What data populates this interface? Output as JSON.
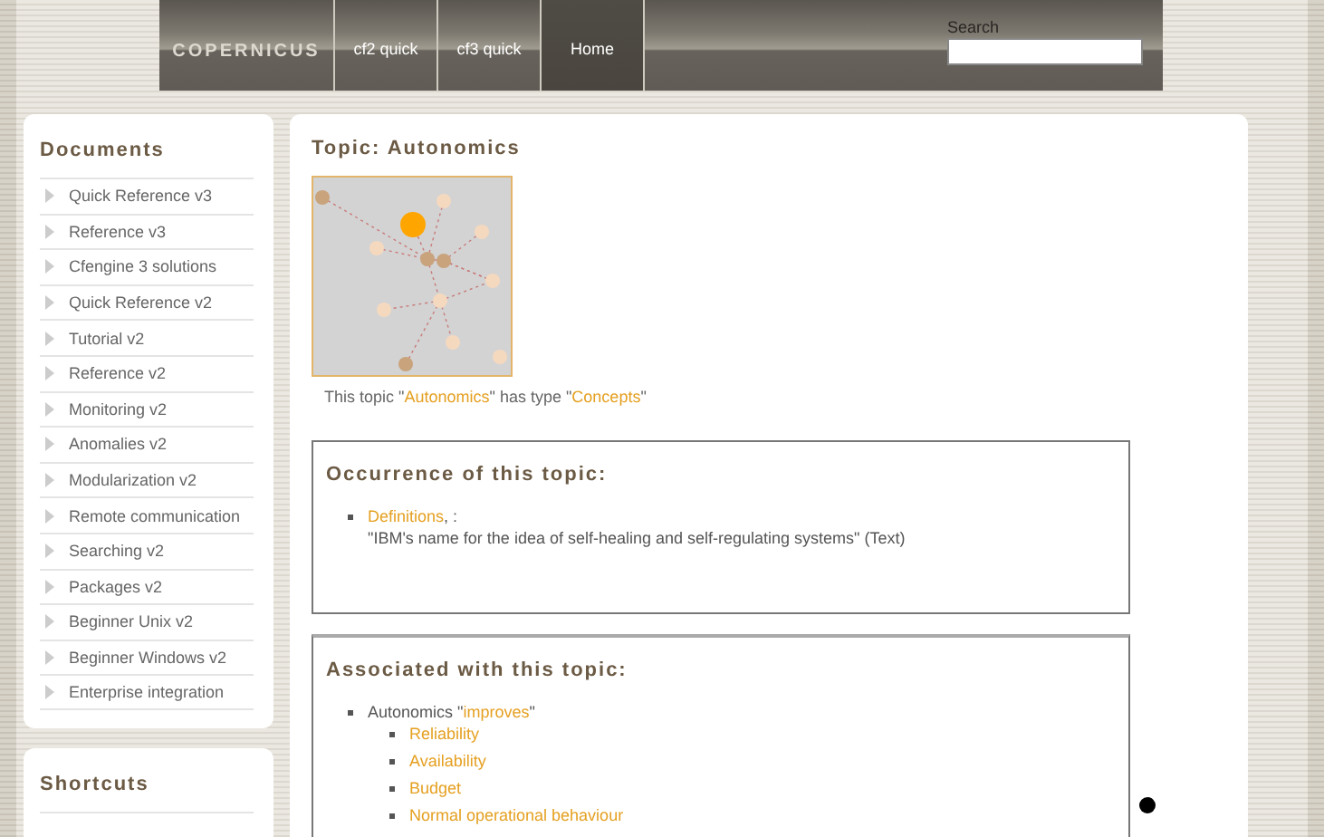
{
  "header": {
    "logo": "COPERNICUS",
    "nav": [
      {
        "label": "cf2 quick",
        "selected": false
      },
      {
        "label": "cf3 quick",
        "selected": false
      },
      {
        "label": "Home",
        "selected": true
      }
    ],
    "search": {
      "label": "Search"
    }
  },
  "sidebar": [
    {
      "title": "Documents",
      "items": [
        "Quick Reference v3",
        "Reference v3",
        "Cfengine 3 solutions",
        "Quick Reference v2",
        "Tutorial v2",
        "Reference v2",
        "Monitoring v2",
        "Anomalies v2",
        "Modularization v2",
        "Remote communication",
        "Searching v2",
        "Packages v2",
        "Beginner Unix v2",
        "Beginner Windows v2",
        "Enterprise integration"
      ]
    },
    {
      "title": "Shortcuts"
    }
  ],
  "topic": {
    "title": "Topic: Autonomics",
    "type_line": {
      "prefix": "This topic \"",
      "topic": "Autonomics",
      "middle": "\" has type \"",
      "type": "Concepts",
      "suffix": "\""
    }
  },
  "occurrence": {
    "title": "Occurrence of this topic:",
    "items": [
      {
        "link": "Definitions",
        "suffix": ", :",
        "text": "\"IBM's name for the idea of self-healing and self-regulating systems\" (Text)"
      }
    ]
  },
  "associated": {
    "title": "Associated with this topic:",
    "items": [
      {
        "subject": "Autonomics \"",
        "relation": "improves",
        "suffix": "\"",
        "children": [
          "Reliability",
          "Availability",
          "Budget",
          "Normal operational behaviour"
        ]
      }
    ]
  }
}
